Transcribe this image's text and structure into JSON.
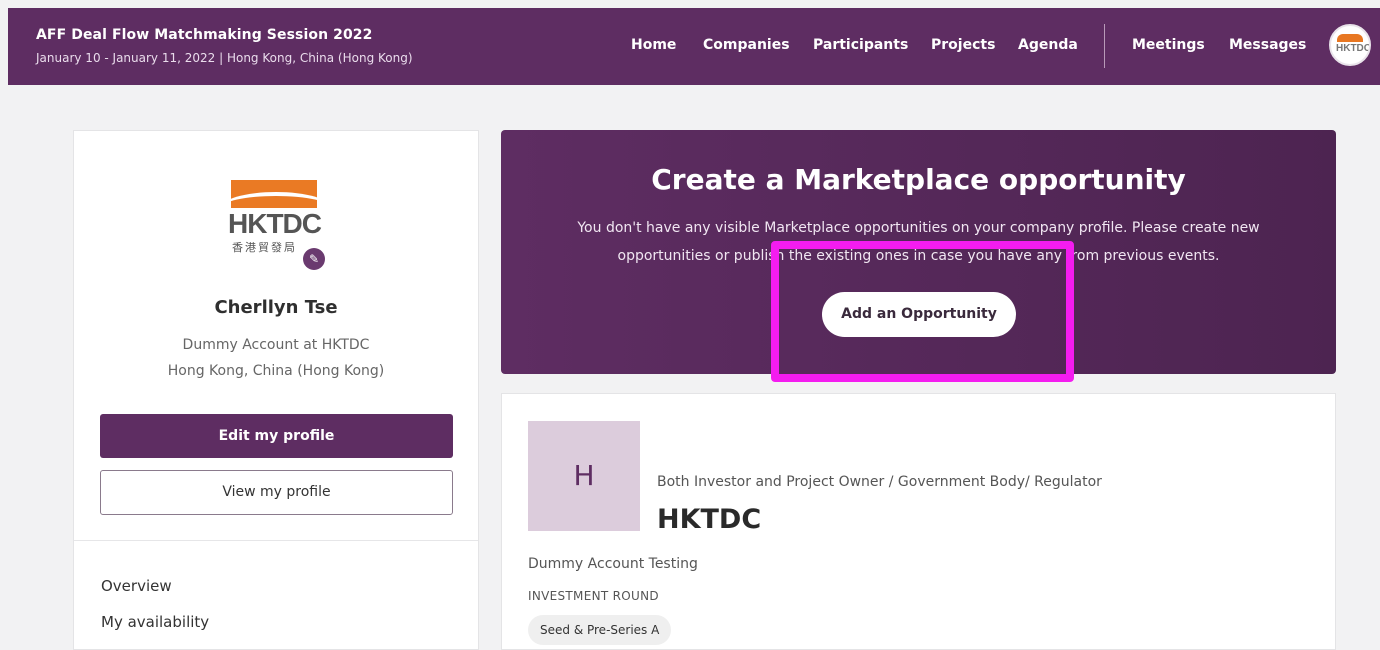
{
  "header": {
    "title": "AFF Deal Flow Matchmaking Session 2022",
    "subtitle": "January 10 - January 11, 2022 | Hong Kong, China (Hong Kong)",
    "nav": {
      "home": "Home",
      "companies": "Companies",
      "participants": "Participants",
      "projects": "Projects",
      "agenda": "Agenda",
      "meetings": "Meetings",
      "messages": "Messages"
    },
    "avatar_text": "HKTDC"
  },
  "profile": {
    "logo_text": "HKTDC",
    "logo_cn": "香港貿發局",
    "name": "Cherllyn Tse",
    "role": "Dummy Account at HKTDC",
    "location": "Hong Kong, China (Hong Kong)",
    "edit_button": "Edit my profile",
    "view_button": "View my profile",
    "menu": [
      "Overview",
      "My availability"
    ]
  },
  "marketplace": {
    "title": "Create a Marketplace opportunity",
    "description": "You don't have any visible Marketplace opportunities on your company profile. Please create new opportunities or publish the existing ones in case you have any from previous events.",
    "button": "Add an Opportunity"
  },
  "company": {
    "initial": "H",
    "type": "Both Investor and Project Owner / Government Body/ Regulator",
    "name": "HKTDC",
    "description": "Dummy Account Testing",
    "investment_label": "INVESTMENT ROUND",
    "investment_tag": "Seed & Pre-Series A"
  },
  "colors": {
    "brand_purple": "#5e2d62",
    "highlight": "#f41cf0",
    "logo_orange": "#ea7a24"
  }
}
